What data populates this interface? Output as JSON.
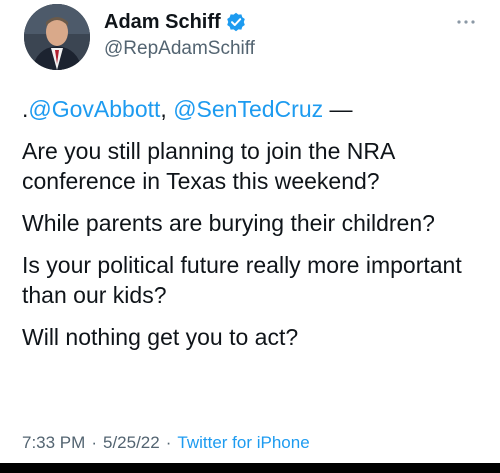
{
  "author": {
    "display_name": "Adam Schiff",
    "handle": "@RepAdamSchiff",
    "verified": true,
    "avatar_icon": "profile-photo-icon",
    "verified_icon": "verified-badge-icon"
  },
  "more_icon": "more-options-icon",
  "tweet": {
    "line1_prefix": ".",
    "mention1": "@GovAbbott",
    "line1_between": ", ",
    "mention2": "@SenTedCruz",
    "line1_suffix": " —",
    "paragraph2": "Are you still planning to join the NRA conference in Texas this weekend?",
    "paragraph3": "While parents are burying their children?",
    "paragraph4": "Is your political future really more important than our kids?",
    "paragraph5": "Will nothing get you to act?"
  },
  "meta": {
    "time": "7:33 PM",
    "date": "5/25/22",
    "source": "Twitter for iPhone",
    "separator": "·"
  },
  "colors": {
    "link": "#1d9bf0",
    "secondary_text": "#536471",
    "primary_text": "#0f1419"
  }
}
